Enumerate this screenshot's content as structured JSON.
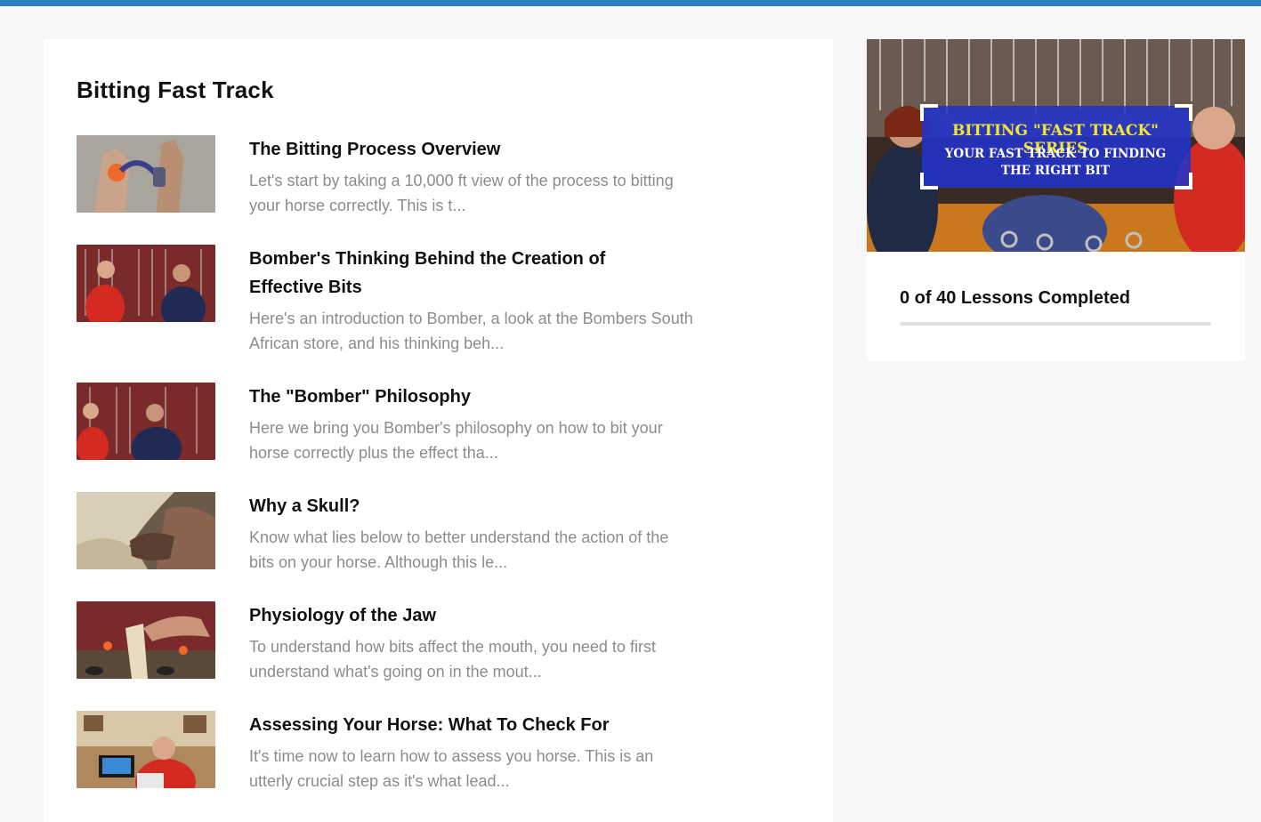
{
  "course": {
    "title": "Bitting Fast Track",
    "lessons": [
      {
        "title": "The Bitting Process Overview",
        "description": "Let's start by taking a 10,000 ft view of the process to bitting your horse correctly. This is t..."
      },
      {
        "title": "Bomber's Thinking Behind the Creation of Effective Bits",
        "description": "Here's an introduction to Bomber, a look at the Bombers South African store, and his thinking beh..."
      },
      {
        "title": "The \"Bomber\" Philosophy",
        "description": "Here we bring you Bomber's philosophy on how to bit your horse correctly plus the effect tha..."
      },
      {
        "title": "Why a Skull?",
        "description": "Know what lies below to better understand the action of the bits on your horse. Although this le..."
      },
      {
        "title": "Physiology of the Jaw",
        "description": "To understand how bits affect the mouth, you need to first understand what's going on in the mout..."
      },
      {
        "title": "Assessing Your Horse: What To Check For",
        "description": "It's time now to learn how to assess you horse. This is an utterly crucial step as it's what lead..."
      }
    ]
  },
  "sidebar": {
    "banner": {
      "line1": "BITTING \"FAST TRACK\" SERIES",
      "line2": "YOUR FAST TRACK TO FINDING",
      "line3": "THE RIGHT BIT"
    },
    "progress_text": "0 of 40 Lessons Completed",
    "progress_fraction": 0
  },
  "colors": {
    "accent": "#2e7fbf",
    "banner_box": "#2233cc",
    "banner_title": "#f2e630"
  }
}
